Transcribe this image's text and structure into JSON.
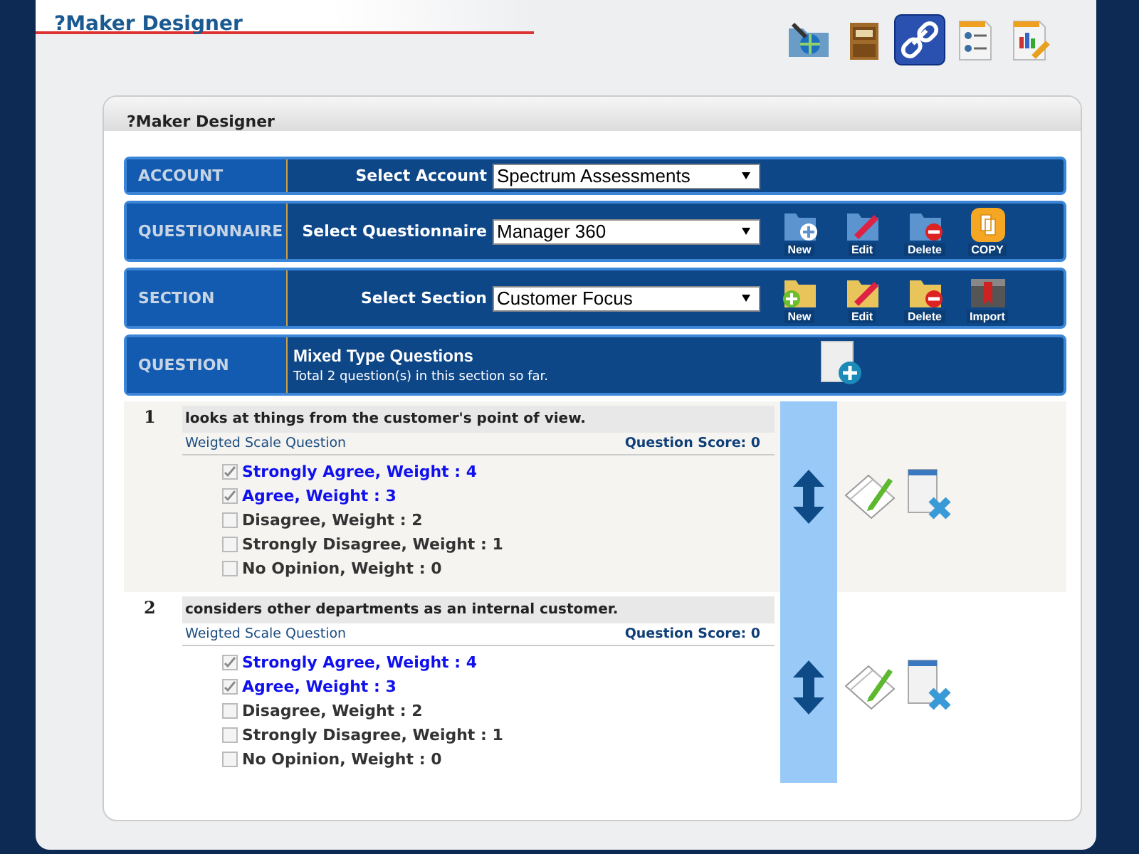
{
  "window": {
    "title": "?Maker Designer"
  },
  "toolbar": [
    {
      "selected": false
    },
    {
      "selected": false
    },
    {
      "selected": true
    },
    {
      "selected": false
    },
    {
      "selected": false
    }
  ],
  "card": {
    "title": "?Maker Designer"
  },
  "bars": [
    {
      "kind": "select",
      "label": "ACCOUNT",
      "field_label": "Select Account",
      "value": "Spectrum Assessments"
    },
    {
      "kind": "select",
      "label": "QUESTIONNAIRE",
      "field_label": "Select Questionnaire",
      "value": "Manager 360",
      "actions": [
        "New",
        "Edit",
        "Delete",
        "COPY"
      ]
    },
    {
      "kind": "select",
      "label": "SECTION",
      "field_label": "Select Section",
      "value": "Customer Focus",
      "actions": [
        "New",
        "Edit",
        "Delete",
        "Import"
      ]
    },
    {
      "kind": "info",
      "label": "QUESTION",
      "heading": "Mixed Type Questions",
      "note": "Total 2 question(s) in this section so far."
    }
  ],
  "questions": [
    {
      "number": "1",
      "text": "looks at things from the customer's point of view.",
      "type": "Weigted Scale Question",
      "score": "Question Score: 0",
      "options": [
        {
          "label": "Strongly Agree, Weight : 4",
          "checked": true
        },
        {
          "label": "Agree, Weight : 3",
          "checked": true
        },
        {
          "label": "Disagree, Weight : 2",
          "checked": false
        },
        {
          "label": "Strongly Disagree, Weight : 1",
          "checked": false
        },
        {
          "label": "No Opinion, Weight : 0",
          "checked": false
        }
      ]
    },
    {
      "number": "2",
      "text": "considers other departments as an internal customer.",
      "type": "Weigted Scale Question",
      "score": "Question Score: 0",
      "options": [
        {
          "label": "Strongly Agree, Weight : 4",
          "checked": true
        },
        {
          "label": "Agree, Weight : 3",
          "checked": true
        },
        {
          "label": "Disagree, Weight : 2",
          "checked": false
        },
        {
          "label": "Strongly Disagree, Weight : 1",
          "checked": false
        },
        {
          "label": "No Opinion, Weight : 0",
          "checked": false
        }
      ]
    }
  ]
}
